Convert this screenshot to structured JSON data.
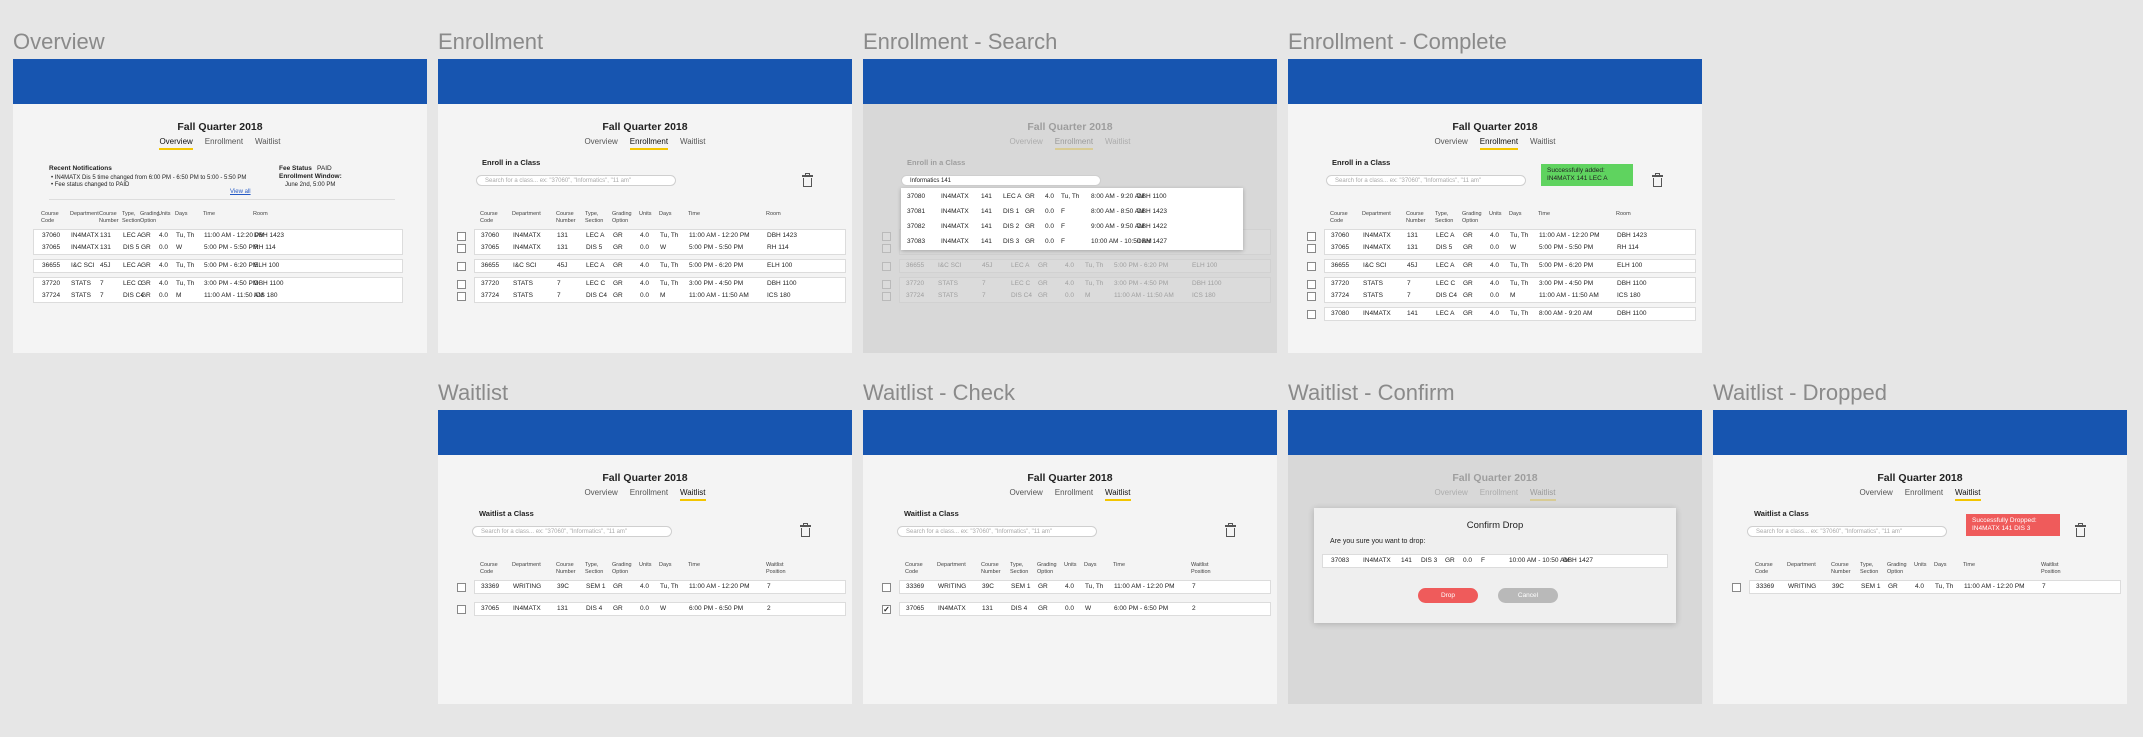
{
  "colors": {
    "header_bar": "#1755b0",
    "active_tab_underline": "#f3c500",
    "success_toast": "#5fd35f",
    "error_toast": "#ef5b5b",
    "canvas": "#e6e6e6"
  },
  "term": "Fall Quarter 2018",
  "tabs": {
    "overview": "Overview",
    "enrollment": "Enrollment",
    "waitlist": "Waitlist"
  },
  "frame_titles": {
    "overview": "Overview",
    "enrollment": "Enrollment",
    "enrollment_search": "Enrollment - Search",
    "enrollment_complete": "Enrollment - Complete",
    "waitlist": "Waitlist",
    "waitlist_check": "Waitlist - Check",
    "waitlist_confirm": "Waitlist - Confirm",
    "waitlist_dropped": "Waitlist - Dropped"
  },
  "enroll_label": "Enroll in a Class",
  "waitlist_label": "Waitlist a Class",
  "search_placeholder": "Search for a class... ex: \"37060\", \"Informatics\", \"11 am\"",
  "search_query": "Informatics 141",
  "icons": {
    "trash": "trash-icon",
    "checkbox": "checkbox-icon"
  },
  "overview": {
    "notifications_title": "Recent Notifications",
    "notifications": [
      "• IN4MATX Dis 5 time changed from 6:00 PM - 6:50 PM to 5:00 - 5:50 PM",
      "• Fee status changed to PAID"
    ],
    "view_all": "View all",
    "fee_status_label": "Fee Status",
    "fee_status_value": "PAID",
    "enrollment_window_label": "Enrollment Window:",
    "enrollment_window_value": "June 2nd, 5:00 PM"
  },
  "columns": {
    "course_code": "Course Code",
    "department": "Department",
    "course_number": "Course Number",
    "type_section": "Type, Section",
    "grading_option": "Grading Option",
    "units": "Units",
    "days": "Days",
    "time": "Time",
    "room": "Room",
    "waitlist_position": "Waitlist Position"
  },
  "enrolled_rows": [
    [
      "37060",
      "IN4MATX",
      "131",
      "LEC A",
      "GR",
      "4.0",
      "Tu, Th",
      "11:00 AM - 12:20 PM",
      "DBH 1423"
    ],
    [
      "37065",
      "IN4MATX",
      "131",
      "DIS  5",
      "GR",
      "0.0",
      "W",
      "5:00 PM - 5:50 PM",
      "RH 114"
    ],
    [
      "36655",
      "I&C SCI",
      "45J",
      "LEC A",
      "GR",
      "4.0",
      "Tu, Th",
      "5:00 PM - 6:20 PM",
      "ELH 100"
    ],
    [
      "37720",
      "STATS",
      "7",
      "LEC C",
      "GR",
      "4.0",
      "Tu, Th",
      "3:00 PM - 4:50 PM",
      "DBH 1100"
    ],
    [
      "37724",
      "STATS",
      "7",
      "DIS C4",
      "GR",
      "0.0",
      "M",
      "11:00 AM - 11:50 AM",
      "ICS 180"
    ]
  ],
  "added_row": [
    "37080",
    "IN4MATX",
    "141",
    "LEC A",
    "GR",
    "4.0",
    "Tu, Th",
    "8:00 AM - 9:20 AM",
    "DBH 1100"
  ],
  "search_results": [
    [
      "37080",
      "IN4MATX",
      "141",
      "LEC A",
      "GR",
      "4.0",
      "Tu, Th",
      "8:00 AM - 9:20 AM",
      "DBH 1100"
    ],
    [
      "37081",
      "IN4MATX",
      "141",
      "DIS  1",
      "GR",
      "0.0",
      "F",
      "8:00 AM - 8:50 AM",
      "DBH 1423"
    ],
    [
      "37082",
      "IN4MATX",
      "141",
      "DIS  2",
      "GR",
      "0.0",
      "F",
      "9:00 AM - 9:50 AM",
      "DBH 1422"
    ],
    [
      "37083",
      "IN4MATX",
      "141",
      "DIS  3",
      "GR",
      "0.0",
      "F",
      "10:00 AM - 10:50 AM",
      "DBH 1427"
    ]
  ],
  "success_toast": [
    "Successfully added:",
    "IN4MATX 141 LEC A"
  ],
  "waitlist_rows": [
    [
      "33369",
      "WRITING",
      "39C",
      "SEM 1",
      "GR",
      "4.0",
      "Tu, Th",
      "11:00 AM - 12:20 PM",
      "7"
    ],
    [
      "37065",
      "IN4MATX",
      "131",
      "DIS  4",
      "GR",
      "0.0",
      "W",
      "6:00 PM - 6:50 PM",
      "2"
    ]
  ],
  "confirm": {
    "title": "Confirm Drop",
    "question": "Are you sure you want to drop:",
    "row": [
      "37083",
      "IN4MATX",
      "141",
      "DIS 3",
      "GR",
      "0.0",
      "F",
      "10:00 AM - 10:50 AM",
      "DBH 1427"
    ],
    "drop": "Drop",
    "cancel": "Cancel"
  },
  "dropped_toast": [
    "Successfully Dropped:",
    "IN4MATX 141 DIS 3"
  ]
}
